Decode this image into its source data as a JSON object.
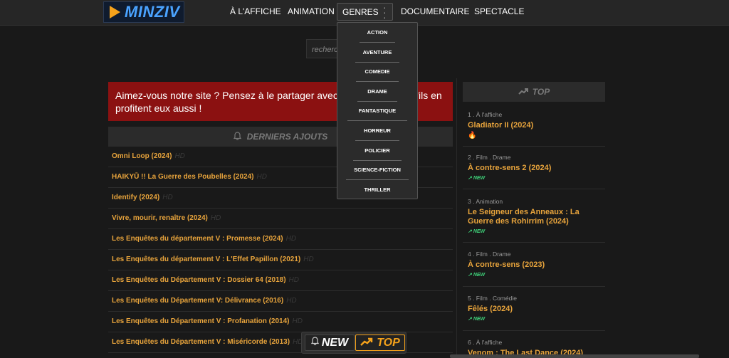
{
  "logo": {
    "text": "MINZIV"
  },
  "nav": {
    "items": [
      "À L'AFFICHE",
      "ANIMATION"
    ],
    "genres_label": "GENRES",
    "items_after": [
      "DOCUMENTAIRE",
      "SPECTACLE"
    ]
  },
  "search": {
    "placeholder": "recherch"
  },
  "banner": {
    "text": "Aimez-vous notre site ? Pensez à le partager avec vos amis pour qu'ils en profitent eux aussi !"
  },
  "latest": {
    "title": "DERNIERS AJOUTS",
    "hd_label": "HD",
    "items": [
      "Omni Loop (2024)",
      "HAIKYŪ !! La Guerre des Poubelles (2024)",
      "Identify (2024)",
      "Vivre, mourir, renaître (2024)",
      "Les Enquêtes du département V : Promesse (2024)",
      "Les Enquêtes du département V : L'Effet Papillon (2021)",
      "Les Enquêtes du Département V : Dossier 64 (2018)",
      "Les Enquêtes du Département V: Délivrance (2016)",
      "Les Enquêtes du Département V : Profanation (2014)",
      "Les Enquêtes du Département V : Miséricorde (2013)"
    ]
  },
  "genres_menu": [
    "ACTION",
    "AVENTURE",
    "COMEDIE",
    "DRAME",
    "FANTASTIQUE",
    "HORREUR",
    "POLICIER",
    "SCIENCE-FICTION",
    "THRILLER"
  ],
  "top": {
    "title": "TOP",
    "items": [
      {
        "cat": "1 . À l'affiche",
        "title": "Gladiator II (2024)",
        "badge": "🔥"
      },
      {
        "cat": "2 . Film . Drame",
        "title": "À contre-sens 2 (2024)",
        "badge": "NEW"
      },
      {
        "cat": "3 . Animation",
        "title": "Le Seigneur des Anneaux : La Guerre des Rohirrim (2024)",
        "badge": "NEW"
      },
      {
        "cat": "4 . Film . Drame",
        "title": "À contre-sens (2023)",
        "badge": "NEW"
      },
      {
        "cat": "5 . Film . Comédie",
        "title": "Fêlés (2024)",
        "badge": "NEW"
      },
      {
        "cat": "6 . À l'affiche",
        "title": "Venom : The Last Dance (2024)",
        "badge": ""
      }
    ]
  },
  "floatbar": {
    "new_label": "NEW",
    "top_label": "TOP"
  },
  "colors": {
    "accent": "#e8a43c",
    "banner": "#8b1111",
    "new_badge": "#3fd37a"
  }
}
